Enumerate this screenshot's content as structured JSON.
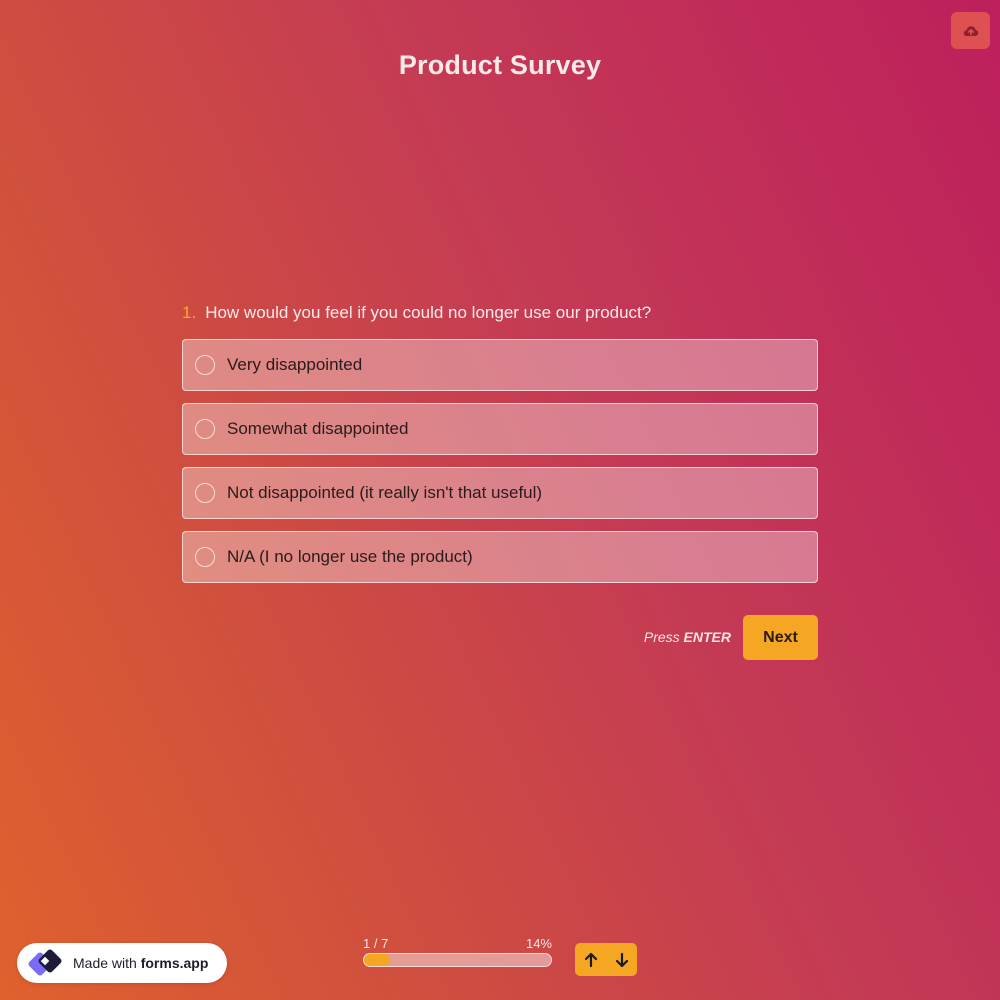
{
  "form": {
    "title": "Product Survey"
  },
  "question": {
    "number": "1.",
    "text": "How would you feel if you could no longer use our product?",
    "options": [
      "Very disappointed",
      "Somewhat disappointed",
      "Not disappointed (it really isn't that useful)",
      "N/A (I no longer use the product)"
    ]
  },
  "actions": {
    "press_label": "Press",
    "enter_key": "ENTER",
    "next_label": "Next"
  },
  "footer": {
    "badge_prefix": "Made with",
    "badge_brand": "forms.app",
    "progress_count": "1 / 7",
    "progress_percent": "14%",
    "progress_value": 0.14
  },
  "colors": {
    "accent": "#f5a623",
    "question_number": "#f8a929",
    "save_button": "#df5052",
    "brand_logo": "#6c5ce7"
  },
  "icons": {
    "save": "cloud-upload-icon",
    "badge_logo": "forms-app-logo-icon",
    "previous": "arrow-up-icon",
    "next": "arrow-down-icon"
  }
}
